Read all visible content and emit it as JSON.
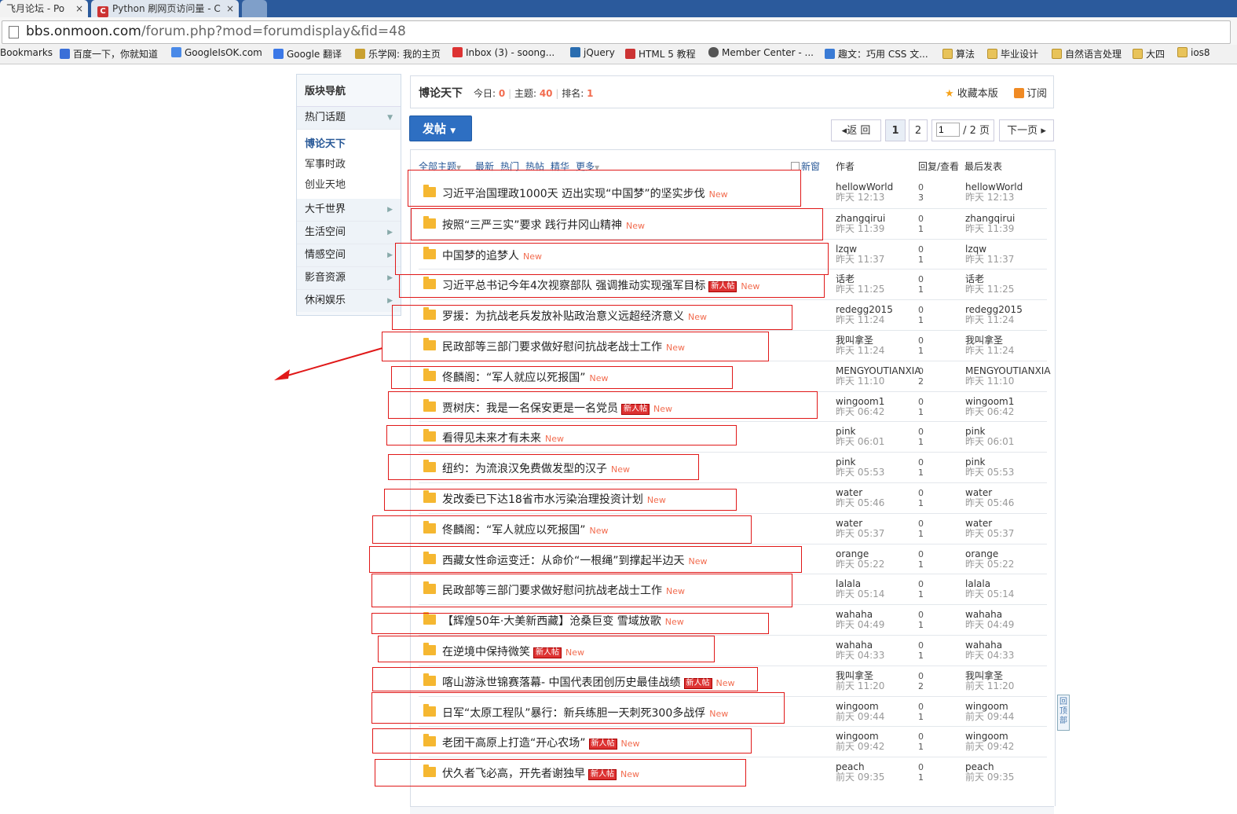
{
  "browser": {
    "tabs": [
      {
        "label": "飞月论坛 - Po",
        "close": "×"
      },
      {
        "label": "Python 刷网页访问量 - C",
        "close": "×"
      }
    ],
    "url_host": "bbs.onmoon.com",
    "url_rest": "/forum.php?mod=forumdisplay&fid=48",
    "bookmarks": [
      {
        "label": "Bookmarks",
        "icon": "none"
      },
      {
        "label": "百度一下，你就知道",
        "icon": "baidu-icon"
      },
      {
        "label": "GoogleIsOK.com",
        "icon": "google-icon"
      },
      {
        "label": "Google 翻译",
        "icon": "translate-icon"
      },
      {
        "label": "乐学网: 我的主页",
        "icon": "lexue-icon"
      },
      {
        "label": "Inbox (3) - soong...",
        "icon": "gmail-icon"
      },
      {
        "label": "jQuery",
        "icon": "jquery-icon"
      },
      {
        "label": "HTML 5 教程",
        "icon": "w3-icon"
      },
      {
        "label": "Member Center - ...",
        "icon": "apple-icon"
      },
      {
        "label": "趣文：巧用 CSS 文...",
        "icon": "b-icon"
      },
      {
        "label": "算法",
        "icon": "folder-icon"
      },
      {
        "label": "毕业设计",
        "icon": "folder-icon"
      },
      {
        "label": "自然语言处理",
        "icon": "folder-icon"
      },
      {
        "label": "大四",
        "icon": "folder-icon"
      },
      {
        "label": "ios8",
        "icon": "folder-icon"
      }
    ]
  },
  "sidebar": {
    "title": "版块导航",
    "hot": "热门话题",
    "sub_items": [
      "博论天下",
      "军事时政",
      "创业天地"
    ],
    "groups": [
      "大千世界",
      "生活空间",
      "情感空间",
      "影音资源",
      "休闲娱乐"
    ]
  },
  "forum": {
    "name": "博论天下",
    "today_label": "今日:",
    "today": "0",
    "topics_label": "主题:",
    "topics": "40",
    "rank_label": "排名:",
    "rank": "1",
    "favorite": "收藏本版",
    "subscribe": "订阅",
    "post_button": "发帖"
  },
  "pager": {
    "back": "返 回",
    "page1": "1",
    "page2": "2",
    "input": "1",
    "total": "/ 2 页",
    "next": "下一页"
  },
  "table_header": {
    "filters": [
      "全部主题",
      "最新",
      "热门",
      "热帖",
      "精华",
      "更多"
    ],
    "new_window": "新窗",
    "author": "作者",
    "reply_view": "回复/查看",
    "last_post": "最后发表"
  },
  "threads": [
    {
      "title": "习近平治国理政1000天 迈出实现“中国梦”的坚实步伐",
      "badge": "",
      "new": "New",
      "author": "hellowWorld",
      "date": "昨天 12:13",
      "replies": "0",
      "views": "3",
      "last_author": "hellowWorld",
      "last_date": "昨天 12:13"
    },
    {
      "title": "按照“三严三实”要求 践行井冈山精神",
      "badge": "",
      "new": "New",
      "author": "zhangqirui",
      "date": "昨天 11:39",
      "replies": "0",
      "views": "1",
      "last_author": "zhangqirui",
      "last_date": "昨天 11:39"
    },
    {
      "title": "中国梦的追梦人",
      "badge": "",
      "new": "New",
      "author": "lzqw",
      "date": "昨天 11:37",
      "replies": "0",
      "views": "1",
      "last_author": "lzqw",
      "last_date": "昨天 11:37"
    },
    {
      "title": "习近平总书记今年4次视察部队 强调推动实现强军目标",
      "badge": "新人帖",
      "new": "New",
      "author": "话老",
      "date": "昨天 11:25",
      "replies": "0",
      "views": "1",
      "last_author": "话老",
      "last_date": "昨天 11:25"
    },
    {
      "title": "罗援：为抗战老兵发放补贴政治意义远超经济意义",
      "badge": "",
      "new": "New",
      "author": "redegg2015",
      "date": "昨天 11:24",
      "replies": "0",
      "views": "1",
      "last_author": "redegg2015",
      "last_date": "昨天 11:24"
    },
    {
      "title": "民政部等三部门要求做好慰问抗战老战士工作",
      "badge": "",
      "new": "New",
      "author": "我叫拿圣",
      "date": "昨天 11:24",
      "replies": "0",
      "views": "1",
      "last_author": "我叫拿圣",
      "last_date": "昨天 11:24"
    },
    {
      "title": "佟麟阁：“军人就应以死报国”",
      "badge": "",
      "new": "New",
      "author": "MENGYOUTIANXIA",
      "date": "昨天 11:10",
      "replies": "0",
      "views": "2",
      "last_author": "MENGYOUTIANXIA",
      "last_date": "昨天 11:10"
    },
    {
      "title": "贾树庆：我是一名保安更是一名党员",
      "badge": "新人帖",
      "new": "New",
      "author": "wingoom1",
      "date": "昨天 06:42",
      "replies": "0",
      "views": "1",
      "last_author": "wingoom1",
      "last_date": "昨天 06:42"
    },
    {
      "title": "看得见未来才有未来",
      "badge": "",
      "new": "New",
      "author": "pink",
      "date": "昨天 06:01",
      "replies": "0",
      "views": "1",
      "last_author": "pink",
      "last_date": "昨天 06:01"
    },
    {
      "title": "纽约：为流浪汉免费做发型的汉子",
      "badge": "",
      "new": "New",
      "author": "pink",
      "date": "昨天 05:53",
      "replies": "0",
      "views": "1",
      "last_author": "pink",
      "last_date": "昨天 05:53"
    },
    {
      "title": "发改委已下达18省市水污染治理投资计划",
      "badge": "",
      "new": "New",
      "author": "water",
      "date": "昨天 05:46",
      "replies": "0",
      "views": "1",
      "last_author": "water",
      "last_date": "昨天 05:46"
    },
    {
      "title": "佟麟阁：“军人就应以死报国”",
      "badge": "",
      "new": "New",
      "author": "water",
      "date": "昨天 05:37",
      "replies": "0",
      "views": "1",
      "last_author": "water",
      "last_date": "昨天 05:37"
    },
    {
      "title": "西藏女性命运变迁：从命价“一根绳”到撑起半边天",
      "badge": "",
      "new": "New",
      "author": "orange",
      "date": "昨天 05:22",
      "replies": "0",
      "views": "1",
      "last_author": "orange",
      "last_date": "昨天 05:22"
    },
    {
      "title": "民政部等三部门要求做好慰问抗战老战士工作",
      "badge": "",
      "new": "New",
      "author": "lalala",
      "date": "昨天 05:14",
      "replies": "0",
      "views": "1",
      "last_author": "lalala",
      "last_date": "昨天 05:14"
    },
    {
      "title": "【辉煌50年·大美新西藏】沧桑巨变 雪域放歌",
      "badge": "",
      "new": "New",
      "author": "wahaha",
      "date": "昨天 04:49",
      "replies": "0",
      "views": "1",
      "last_author": "wahaha",
      "last_date": "昨天 04:49"
    },
    {
      "title": "在逆境中保持微笑",
      "badge": "新人帖",
      "new": "New",
      "author": "wahaha",
      "date": "昨天 04:33",
      "replies": "0",
      "views": "1",
      "last_author": "wahaha",
      "last_date": "昨天 04:33"
    },
    {
      "title": "喀山游泳世锦赛落幕- 中国代表团创历史最佳战绩",
      "badge": "新人帖",
      "new": "New",
      "author": "我叫拿圣",
      "date": "前天 11:20",
      "replies": "0",
      "views": "2",
      "last_author": "我叫拿圣",
      "last_date": "前天 11:20"
    },
    {
      "title": "日军“太原工程队”暴行：新兵练胆一天刺死300多战俘",
      "badge": "",
      "new": "New",
      "author": "wingoom",
      "date": "前天 09:44",
      "replies": "0",
      "views": "1",
      "last_author": "wingoom",
      "last_date": "前天 09:44"
    },
    {
      "title": "老团干高原上打造“开心农场”",
      "badge": "新人帖",
      "new": "New",
      "author": "wingoom",
      "date": "前天 09:42",
      "replies": "0",
      "views": "1",
      "last_author": "wingoom",
      "last_date": "前天 09:42"
    },
    {
      "title": "伏久者飞必高，开先者谢独早",
      "badge": "新人帖",
      "new": "New",
      "author": "peach",
      "date": "前天 09:35",
      "replies": "0",
      "views": "1",
      "last_author": "peach",
      "last_date": "前天 09:35"
    }
  ],
  "to_top": "回顶部",
  "colors": {
    "accent": "#2e6fc2",
    "new": "#f26c4f",
    "highlight": "#e01818"
  }
}
